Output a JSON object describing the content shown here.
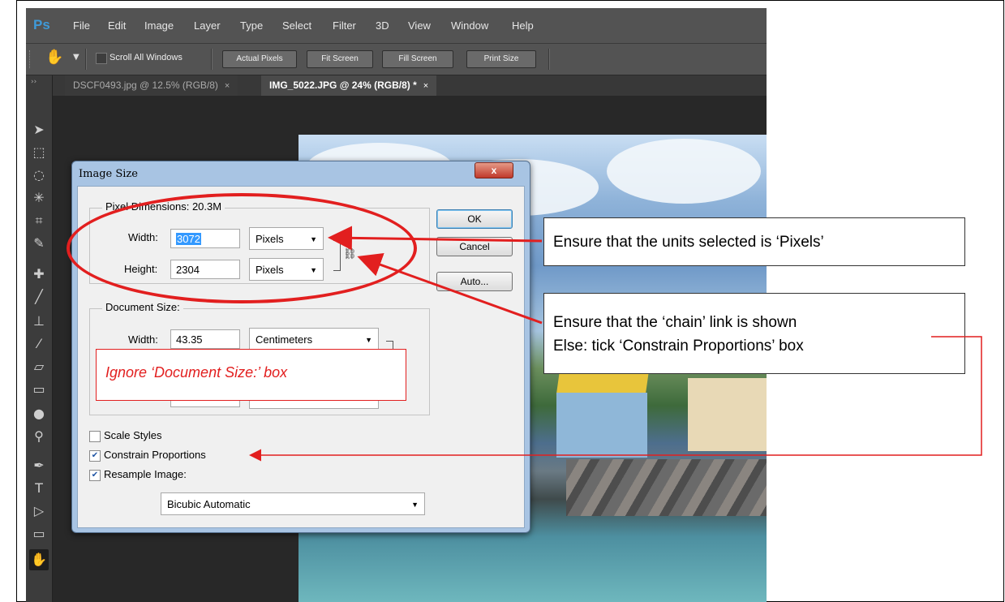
{
  "app": {
    "logo": "Ps",
    "menu": [
      "File",
      "Edit",
      "Image",
      "Layer",
      "Type",
      "Select",
      "Filter",
      "3D",
      "View",
      "Window",
      "Help"
    ]
  },
  "options_bar": {
    "scroll_all_label": "Scroll All Windows",
    "buttons": [
      "Actual Pixels",
      "Fit Screen",
      "Fill Screen",
      "Print Size"
    ]
  },
  "tabs": [
    {
      "label": "DSCF0493.jpg @ 12.5% (RGB/8)",
      "close": "×"
    },
    {
      "label": "IMG_5022.JPG @ 24% (RGB/8) *",
      "close": "×"
    }
  ],
  "toolbar_expand": "››",
  "dialog": {
    "title": "Image Size",
    "close_glyph": "x",
    "pixel_dimensions": {
      "legend": "Pixel Dimensions:",
      "size": "20.3M",
      "width_label": "Width:",
      "width_value": "3072",
      "width_unit": "Pixels",
      "height_label": "Height:",
      "height_value": "2304",
      "height_unit": "Pixels"
    },
    "document_size": {
      "legend": "Document Size:",
      "width_label": "Width:",
      "width_value": "43.35",
      "width_unit": "Centimeters"
    },
    "buttons": {
      "ok": "OK",
      "cancel": "Cancel",
      "auto": "Auto..."
    },
    "options": {
      "scale_styles": "Scale Styles",
      "constrain_proportions": "Constrain Proportions",
      "resample_image": "Resample Image:",
      "resample_method": "Bicubic Automatic"
    },
    "checkbox_states": {
      "scale_styles": false,
      "constrain_proportions": true,
      "resample_image": true
    }
  },
  "annotations": {
    "units_note": "Ensure that the units selected is ‘Pixels’",
    "chain_note_line1": "Ensure that the ‘chain’ link is shown",
    "chain_note_line2": "Else: tick ‘Constrain Proportions’ box",
    "ignore_note": "Ignore ‘Document Size:’ box",
    "accent_color": "#e21f1f"
  }
}
